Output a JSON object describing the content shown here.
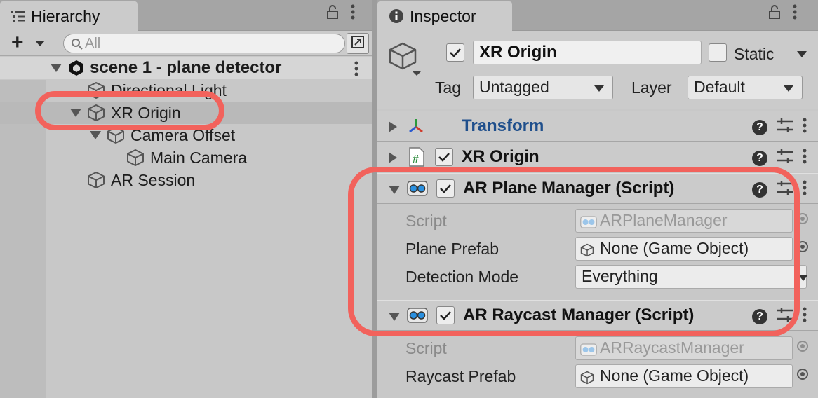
{
  "hierarchy": {
    "tab_label": "Hierarchy",
    "search_placeholder": "All",
    "scene_name": "scene 1 - plane detector",
    "items": [
      {
        "label": "Directional Light"
      },
      {
        "label": "XR Origin"
      },
      {
        "label": "Camera Offset"
      },
      {
        "label": "Main Camera"
      },
      {
        "label": "AR Session"
      }
    ]
  },
  "inspector": {
    "tab_label": "Inspector",
    "object_name": "XR Origin",
    "static_label": "Static",
    "tag_label": "Tag",
    "tag_value": "Untagged",
    "layer_label": "Layer",
    "layer_value": "Default",
    "components": {
      "transform": {
        "title": "Transform"
      },
      "xr_origin": {
        "title": "XR Origin"
      },
      "plane_manager": {
        "title": "AR Plane Manager (Script)",
        "script_label": "Script",
        "script_value": "ARPlaneManager",
        "prefab_label": "Plane Prefab",
        "prefab_value": "None (Game Object)",
        "detection_label": "Detection Mode",
        "detection_value": "Everything"
      },
      "raycast_manager": {
        "title": "AR Raycast Manager (Script)",
        "script_label": "Script",
        "script_value": "ARRaycastManager",
        "prefab_label": "Raycast Prefab",
        "prefab_value": "None (Game Object)"
      }
    }
  },
  "colors": {
    "highlight": "#f2625c",
    "transform_title": "#1f4f8c"
  }
}
